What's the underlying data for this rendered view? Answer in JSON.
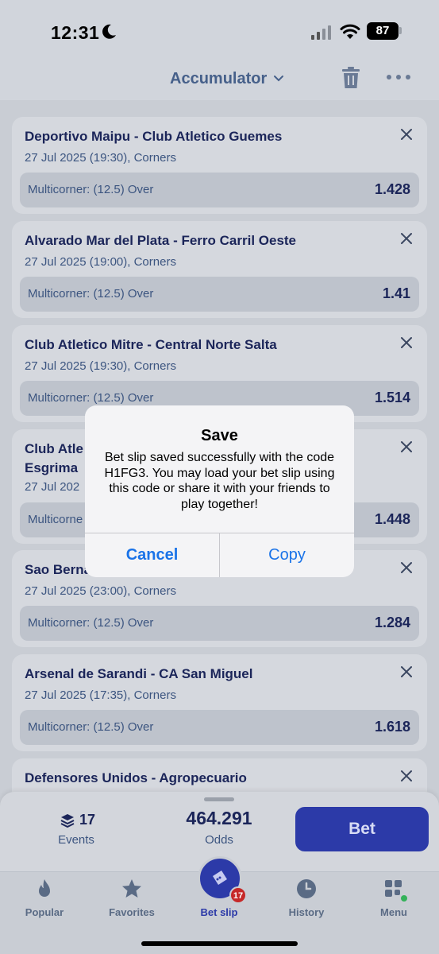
{
  "status": {
    "time": "12:31",
    "battery": "87"
  },
  "header": {
    "title": "Accumulator"
  },
  "bets": [
    {
      "title": "Deportivo Maipu - Club Atletico Guemes",
      "sub": "27 Jul 2025 (19:30), Corners",
      "market": "Multicorner: (12.5) Over",
      "odds": "1.428"
    },
    {
      "title": "Alvarado Mar del Plata - Ferro Carril Oeste",
      "sub": "27 Jul 2025 (19:00), Corners",
      "market": "Multicorner: (12.5) Over",
      "odds": "1.41"
    },
    {
      "title": "Club Atletico Mitre - Central Norte Salta",
      "sub": "27 Jul 2025 (19:30), Corners",
      "market": "Multicorner: (12.5) Over",
      "odds": "1.514"
    },
    {
      "title": "Club Atle",
      "title2": "Esgrima",
      "sub": "27 Jul 202",
      "market": "Multicorne",
      "odds": "1.448"
    },
    {
      "title": "Sao Berna",
      "sub": "27 Jul 2025 (23:00), Corners",
      "market": "Multicorner: (12.5) Over",
      "odds": "1.284"
    },
    {
      "title": "Arsenal de Sarandi - CA San Miguel",
      "sub": "27 Jul 2025 (17:35), Corners",
      "market": "Multicorner: (12.5) Over",
      "odds": "1.618"
    },
    {
      "title": "Defensores Unidos - Agropecuario"
    }
  ],
  "dialog": {
    "title": "Save",
    "message": "Bet slip saved successfully with the code H1FG3. You may load your bet slip using this code or share it with your friends to play together!",
    "cancel": "Cancel",
    "copy": "Copy"
  },
  "summary": {
    "events_count": "17",
    "events_label": "Events",
    "odds_value": "464.291",
    "odds_label": "Odds",
    "bet_label": "Bet"
  },
  "tabs": {
    "popular": "Popular",
    "favorites": "Favorites",
    "betslip": "Bet slip",
    "betslip_badge": "17",
    "history": "History",
    "menu": "Menu"
  }
}
